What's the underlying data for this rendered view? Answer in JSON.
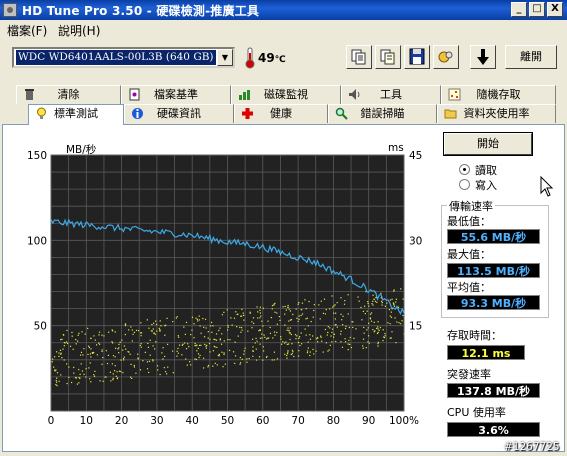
{
  "window": {
    "title": "HD Tune Pro 3.50 - 硬碟檢測-推廣工具",
    "minimize_label": "_",
    "maximize_label": "□",
    "close_label": "X"
  },
  "menu": {
    "items": [
      {
        "label": "檔案(F)"
      },
      {
        "label": "說明(H)"
      }
    ]
  },
  "toolbar": {
    "drive": "WDC WD6401AALS-00L3B (640 GB)",
    "dropdown_arrow": "▼",
    "temperature": "49",
    "temperature_unit": "℃",
    "exit_label": "離開"
  },
  "tabs": {
    "row1": [
      {
        "label": "清除"
      },
      {
        "label": "檔案基準"
      },
      {
        "label": "磁碟監視"
      },
      {
        "label": "工具"
      },
      {
        "label": "隨機存取"
      }
    ],
    "row2": [
      {
        "label": "標準測試"
      },
      {
        "label": "硬碟資訊"
      },
      {
        "label": "健康"
      },
      {
        "label": "錯誤掃瞄"
      },
      {
        "label": "資料夾使用率"
      }
    ]
  },
  "controls": {
    "start_label": "開始",
    "read_label": "讀取",
    "write_label": "寫入",
    "read_selected": true
  },
  "stats": {
    "transfer_title": "傳輸速率",
    "min_label": "最低值：",
    "min_value": "55.6 MB/秒",
    "max_label": "最大值：",
    "max_value": "113.5 MB/秒",
    "avg_label": "平均值：",
    "avg_value": "93.3 MB/秒",
    "access_label": "存取時間：",
    "access_value": "12.1 ms",
    "burst_label": "突發速率",
    "burst_value": "137.8 MB/秒",
    "cpu_label": "CPU 使用率",
    "cpu_value": "3.6%"
  },
  "watermark": "#1267725",
  "chart_data": {
    "type": "line",
    "ylabel_left": "MB/秒",
    "ylabel_right": "ms",
    "xlim": [
      0,
      100
    ],
    "ylim_left": [
      0,
      150
    ],
    "ylim_right": [
      0,
      45
    ],
    "x_ticks": [
      "0",
      "10",
      "20",
      "30",
      "40",
      "50",
      "60",
      "70",
      "80",
      "90",
      "100%"
    ],
    "y_left_ticks": [
      "150",
      "100",
      "50"
    ],
    "y_right_ticks": [
      "45",
      "30",
      "15"
    ],
    "grid": true,
    "series": [
      {
        "role": "transfer rate",
        "color": "#3fa9e6",
        "x": [
          0,
          5,
          10,
          15,
          20,
          25,
          30,
          35,
          40,
          45,
          50,
          55,
          60,
          65,
          70,
          75,
          80,
          85,
          90,
          95,
          100
        ],
        "y": [
          111,
          110,
          109,
          108,
          107,
          106,
          105,
          104,
          103,
          101,
          99,
          98,
          96,
          93,
          90,
          87,
          82,
          77,
          71,
          64,
          57
        ]
      },
      {
        "role": "access time scatter",
        "color": "#e8e840",
        "x_range": [
          0,
          100
        ],
        "y_range_ms": [
          7,
          22
        ]
      }
    ]
  }
}
